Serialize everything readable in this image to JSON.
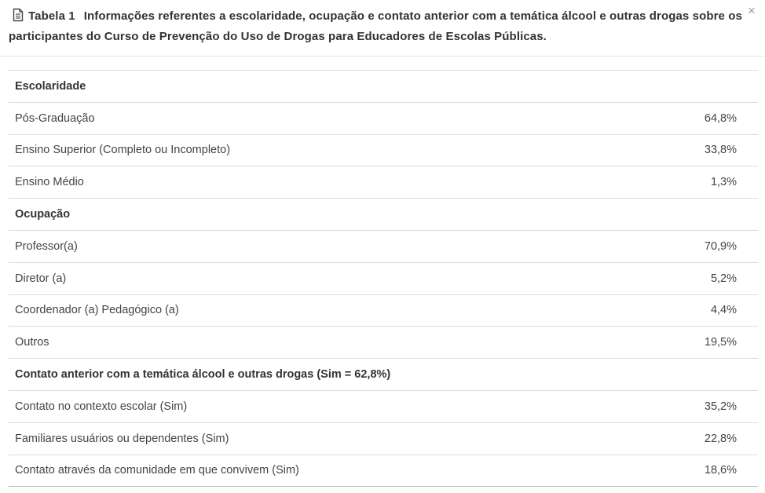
{
  "dialog": {
    "label": "Tabela 1",
    "title": "Informações referentes a escolaridade, ocupação e contato anterior com a temática álcool e outras drogas sobre os participantes do Curso de Prevenção do Uso de Drogas para Educadores de Escolas Públicas.",
    "close_label": "×",
    "icon": "document-icon"
  },
  "table": {
    "rows": [
      {
        "label": "Escolaridade",
        "value": "",
        "section": true
      },
      {
        "label": "Pós-Graduação",
        "value": "64,8%"
      },
      {
        "label": "Ensino Superior (Completo ou Incompleto)",
        "value": "33,8%"
      },
      {
        "label": "Ensino Médio",
        "value": "1,3%"
      },
      {
        "label": "Ocupação",
        "value": "",
        "section": true
      },
      {
        "label": "Professor(a)",
        "value": "70,9%"
      },
      {
        "label": "Diretor (a)",
        "value": "5,2%"
      },
      {
        "label": "Coordenador (a) Pedagógico (a)",
        "value": "4,4%"
      },
      {
        "label": "Outros",
        "value": "19,5%"
      },
      {
        "label": "Contato anterior com a temática álcool e outras drogas (Sim = 62,8%)",
        "value": "",
        "section": true
      },
      {
        "label": "Contato no contexto escolar (Sim)",
        "value": "35,2%"
      },
      {
        "label": "Familiares usuários ou dependentes (Sim)",
        "value": "22,8%"
      },
      {
        "label": "Contato através da comunidade em que convivem (Sim)",
        "value": "18,6%"
      }
    ]
  }
}
